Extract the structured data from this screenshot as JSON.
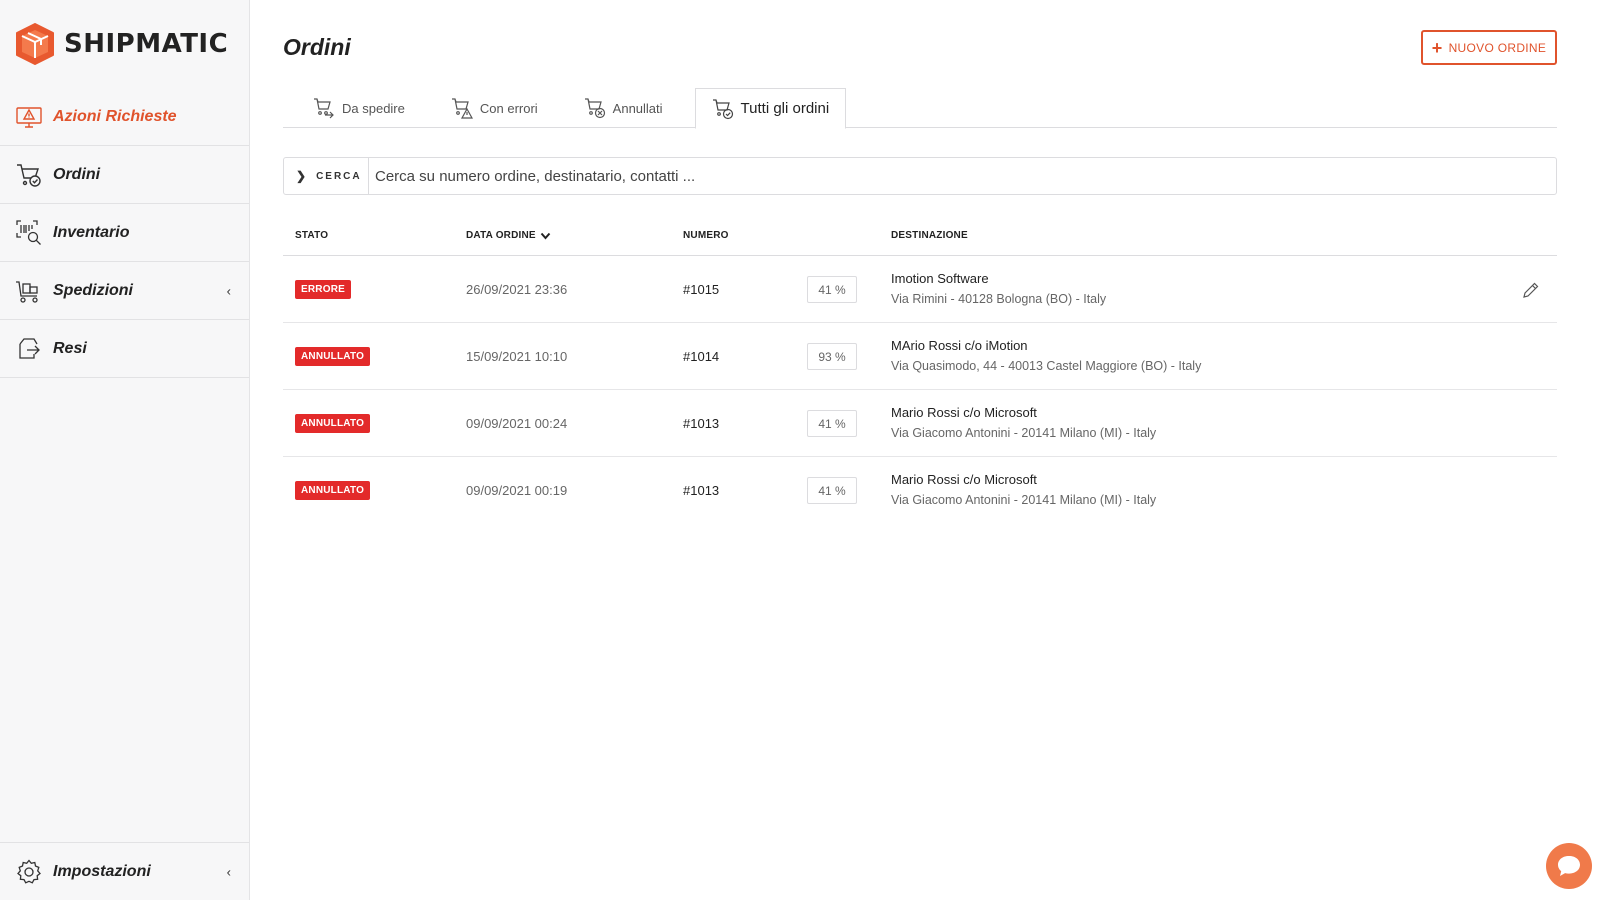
{
  "brand": {
    "name": "SHIPMATIC",
    "accent": "#e0532c"
  },
  "sidebar": {
    "items": [
      {
        "label": "Azioni Richieste",
        "icon": "alert-monitor-icon",
        "active": true
      },
      {
        "label": "Ordini",
        "icon": "cart-icon"
      },
      {
        "label": "Inventario",
        "icon": "barcode-search-icon"
      },
      {
        "label": "Spedizioni",
        "icon": "delivery-cart-icon",
        "chevron": "‹"
      },
      {
        "label": "Resi",
        "icon": "return-icon"
      }
    ],
    "settings": {
      "label": "Impostazioni",
      "icon": "gear-icon",
      "chevron": "‹"
    }
  },
  "header": {
    "title": "Ordini",
    "new_order_label": "NUOVO ORDINE"
  },
  "tabs": [
    {
      "label": "Da spedire",
      "icon": "cart-shipping-icon"
    },
    {
      "label": "Con errori",
      "icon": "cart-warning-icon"
    },
    {
      "label": "Annullati",
      "icon": "cart-cancel-icon"
    },
    {
      "label": "Tutti gli ordini",
      "icon": "cart-check-icon",
      "active": true
    }
  ],
  "search": {
    "button_label": "CERCA",
    "placeholder": "Cerca su numero ordine, destinatario, contatti ..."
  },
  "table": {
    "columns": {
      "stato": "STATO",
      "data": "DATA ORDINE",
      "numero": "NUMERO",
      "destinazione": "DESTINAZIONE"
    },
    "rows": [
      {
        "status": "ERRORE",
        "date": "26/09/2021 23:36",
        "number": "#1015",
        "percent": "41 %",
        "dest_name": "Imotion Software",
        "dest_address": "Via Rimini - 40128 Bologna (BO) - Italy",
        "editable": true
      },
      {
        "status": "ANNULLATO",
        "date": "15/09/2021 10:10",
        "number": "#1014",
        "percent": "93 %",
        "dest_name": "MArio Rossi c/o iMotion",
        "dest_address": "Via Quasimodo, 44 - 40013 Castel Maggiore (BO) - Italy"
      },
      {
        "status": "ANNULLATO",
        "date": "09/09/2021 00:24",
        "number": "#1013",
        "percent": "41 %",
        "dest_name": "Mario Rossi c/o Microsoft",
        "dest_address": "Via Giacomo Antonini - 20141 Milano (MI) - Italy"
      },
      {
        "status": "ANNULLATO",
        "date": "09/09/2021 00:19",
        "number": "#1013",
        "percent": "41 %",
        "dest_name": "Mario Rossi c/o Microsoft",
        "dest_address": "Via Giacomo Antonini - 20141 Milano (MI) - Italy"
      }
    ]
  }
}
